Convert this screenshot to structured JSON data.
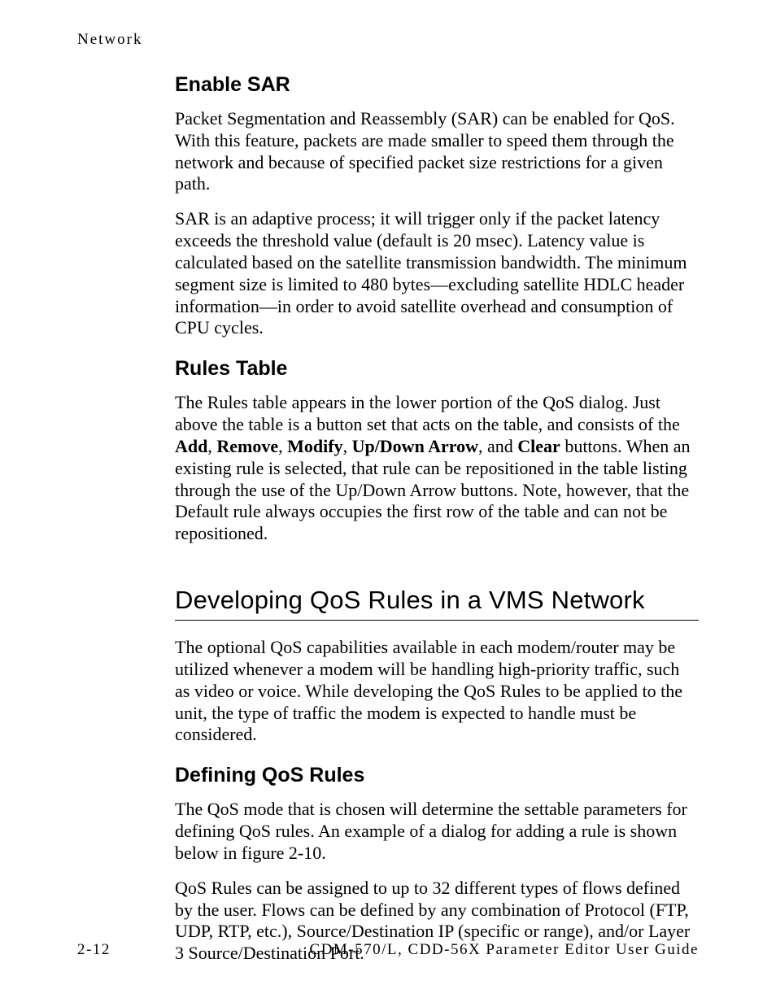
{
  "runningHead": "Network",
  "sections": {
    "enableSar": {
      "title": "Enable SAR",
      "p1": "Packet Segmentation and Reassembly (SAR) can be enabled for QoS. With this feature, packets are made smaller to speed them through the network and because of specified packet size restrictions for a given path.",
      "p2": "SAR is an adaptive process; it will trigger only if the packet latency exceeds the threshold value (default is 20 msec). Latency value is calculated based on the satellite transmission bandwidth. The minimum segment size is limited to 480 bytes—excluding satellite HDLC header information—in order to avoid satellite overhead and consumption of CPU cycles."
    },
    "rulesTable": {
      "title": "Rules Table",
      "p1_a": "The Rules table appears in the lower portion of the QoS dialog. Just above the table is a button set that acts on the table, and consists of the ",
      "add": "Add",
      "sep1": ", ",
      "remove": "Remove",
      "sep2": ", ",
      "modify": "Modify",
      "sep3": ", ",
      "updown": "Up/Down Arrow",
      "sep4": ", and ",
      "clear": "Clear",
      "p1_b": " buttons. When an existing rule is selected, that rule can be repositioned in the table listing through the use of the Up/Down Arrow buttons. Note, however, that the Default rule always occupies the first row of the table and can not be repositioned."
    },
    "devQos": {
      "title": "Developing QoS Rules in a VMS Network",
      "p1": "The optional QoS capabilities available in each modem/router may be utilized whenever a modem will be handling high-priority traffic, such as video or voice. While developing the QoS Rules to be applied to the unit, the type of traffic the modem is expected to handle must be considered."
    },
    "defQos": {
      "title": "Defining QoS Rules",
      "p1": "The QoS mode that is chosen will determine the settable parameters for defining QoS rules. An example of a dialog for adding a rule is shown below in figure 2-10.",
      "p2": "QoS Rules can be assigned to up to 32 different types of flows defined by the user. Flows can be defined by any combination of Protocol (FTP, UDP, RTP, etc.), Source/Destination IP (specific or range), and/or Layer 3 Source/Destination Port."
    }
  },
  "footer": {
    "pageNum": "2-12",
    "docTitle": "CDM-570/L, CDD-56X Parameter Editor User Guide"
  }
}
